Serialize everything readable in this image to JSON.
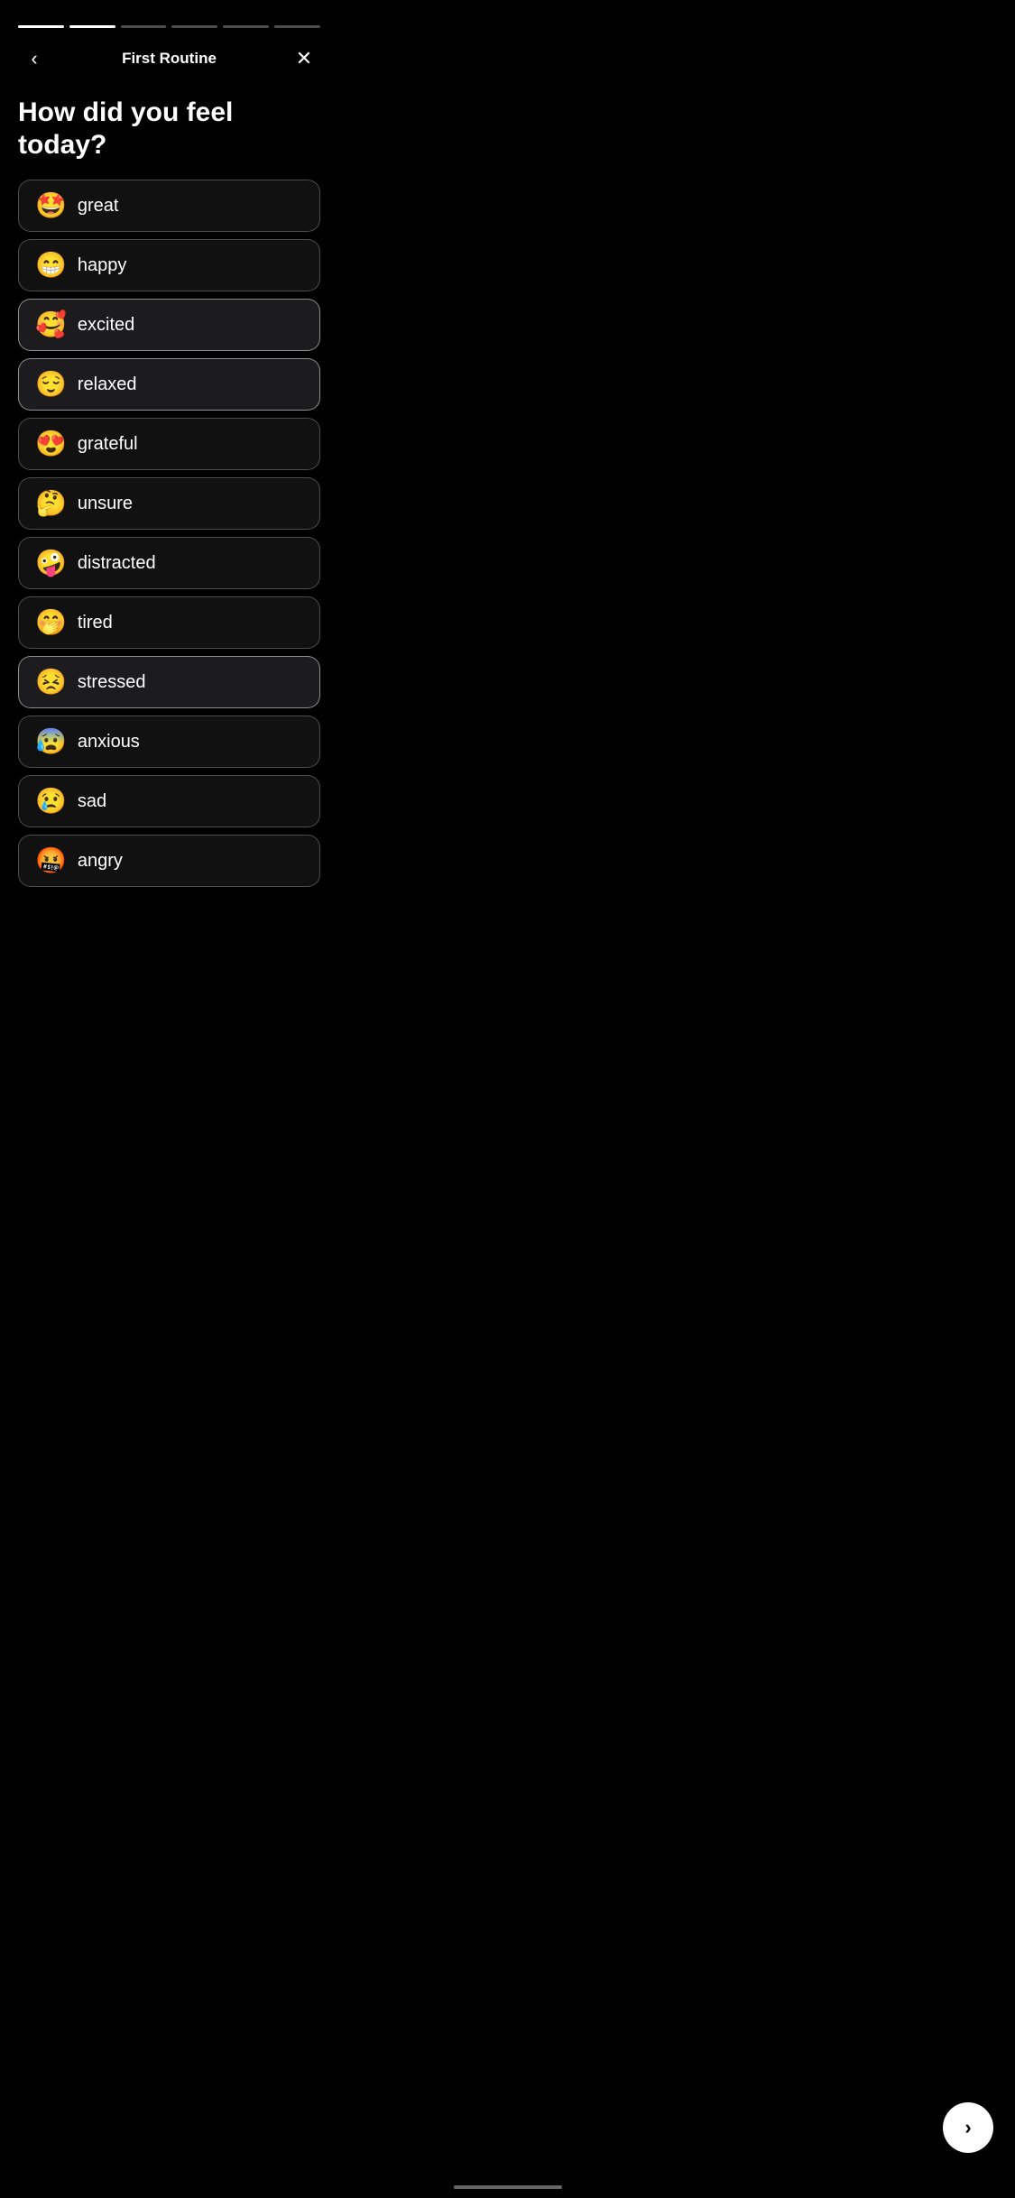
{
  "header": {
    "title": "First Routine",
    "back_label": "‹",
    "close_label": "✕"
  },
  "progress": {
    "segments": [
      {
        "id": 1,
        "active": true
      },
      {
        "id": 2,
        "active": true
      },
      {
        "id": 3,
        "active": false
      },
      {
        "id": 4,
        "active": false
      },
      {
        "id": 5,
        "active": false
      },
      {
        "id": 6,
        "active": false
      }
    ]
  },
  "page_title": "How did you feel today?",
  "feelings": [
    {
      "id": "great",
      "emoji": "🤩",
      "label": "great",
      "selected": false
    },
    {
      "id": "happy",
      "emoji": "😁",
      "label": "happy",
      "selected": false
    },
    {
      "id": "excited",
      "emoji": "🥰",
      "label": "excited",
      "selected": true
    },
    {
      "id": "relaxed",
      "emoji": "😌",
      "label": "relaxed",
      "selected": true
    },
    {
      "id": "grateful",
      "emoji": "😍",
      "label": "grateful",
      "selected": false
    },
    {
      "id": "unsure",
      "emoji": "🤔",
      "label": "unsure",
      "selected": false
    },
    {
      "id": "distracted",
      "emoji": "🤪",
      "label": "distracted",
      "selected": false
    },
    {
      "id": "tired",
      "emoji": "🤭",
      "label": "tired",
      "selected": false
    },
    {
      "id": "stressed",
      "emoji": "😣",
      "label": "stressed",
      "selected": true
    },
    {
      "id": "anxious",
      "emoji": "😰",
      "label": "anxious",
      "selected": false
    },
    {
      "id": "sad",
      "emoji": "😢",
      "label": "sad",
      "selected": false
    },
    {
      "id": "angry",
      "emoji": "🤬",
      "label": "angry",
      "selected": false
    }
  ],
  "next_button": {
    "label": "›",
    "aria": "Next"
  }
}
